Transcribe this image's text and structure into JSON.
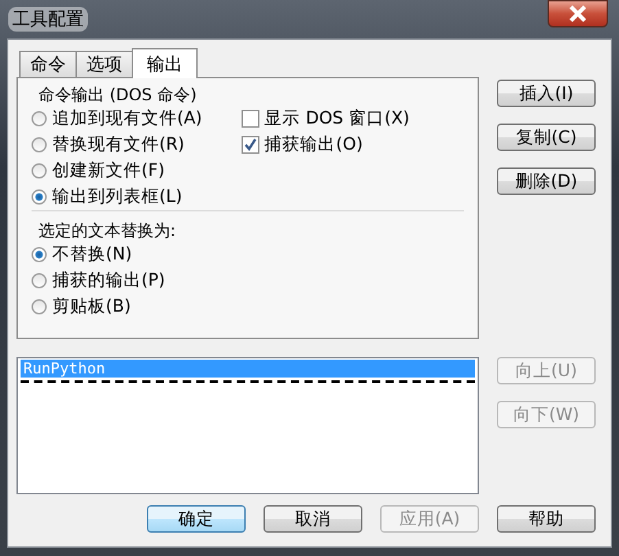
{
  "window": {
    "title": "工具配置"
  },
  "tabs": [
    {
      "label": "命令",
      "selected": false
    },
    {
      "label": "选项",
      "selected": false
    },
    {
      "label": "输出",
      "selected": true
    }
  ],
  "output_group": {
    "title": "命令输出 (DOS 命令)",
    "radios": [
      {
        "label": "追加到现有文件(A)",
        "selected": false
      },
      {
        "label": "替换现有文件(R)",
        "selected": false
      },
      {
        "label": "创建新文件(F)",
        "selected": false
      },
      {
        "label": "输出到列表框(L)",
        "selected": true
      }
    ],
    "checkboxes": [
      {
        "label": "显示 DOS 窗口(X)",
        "checked": false
      },
      {
        "label": "捕获输出(O)",
        "checked": true
      }
    ]
  },
  "replace_group": {
    "title": "选定的文本替换为:",
    "radios": [
      {
        "label": "不替换(N)",
        "selected": true
      },
      {
        "label": "捕获的输出(P)",
        "selected": false
      },
      {
        "label": "剪贴板(B)",
        "selected": false
      }
    ]
  },
  "side_buttons": [
    {
      "label": "插入(I)",
      "disabled": false
    },
    {
      "label": "复制(C)",
      "disabled": false
    },
    {
      "label": "删除(D)",
      "disabled": false
    }
  ],
  "list": [
    {
      "kind": "command",
      "text": "RunPython",
      "selected": true
    },
    {
      "kind": "separator"
    }
  ],
  "move_buttons": [
    {
      "label": "向上(U)",
      "disabled": true
    },
    {
      "label": "向下(W)",
      "disabled": true
    }
  ],
  "bottom_buttons": [
    {
      "label": "确定",
      "disabled": false,
      "default": true
    },
    {
      "label": "取消",
      "disabled": false,
      "default": false
    },
    {
      "label": "应用(A)",
      "disabled": true,
      "default": false
    },
    {
      "label": "帮助",
      "disabled": false,
      "default": false
    }
  ]
}
